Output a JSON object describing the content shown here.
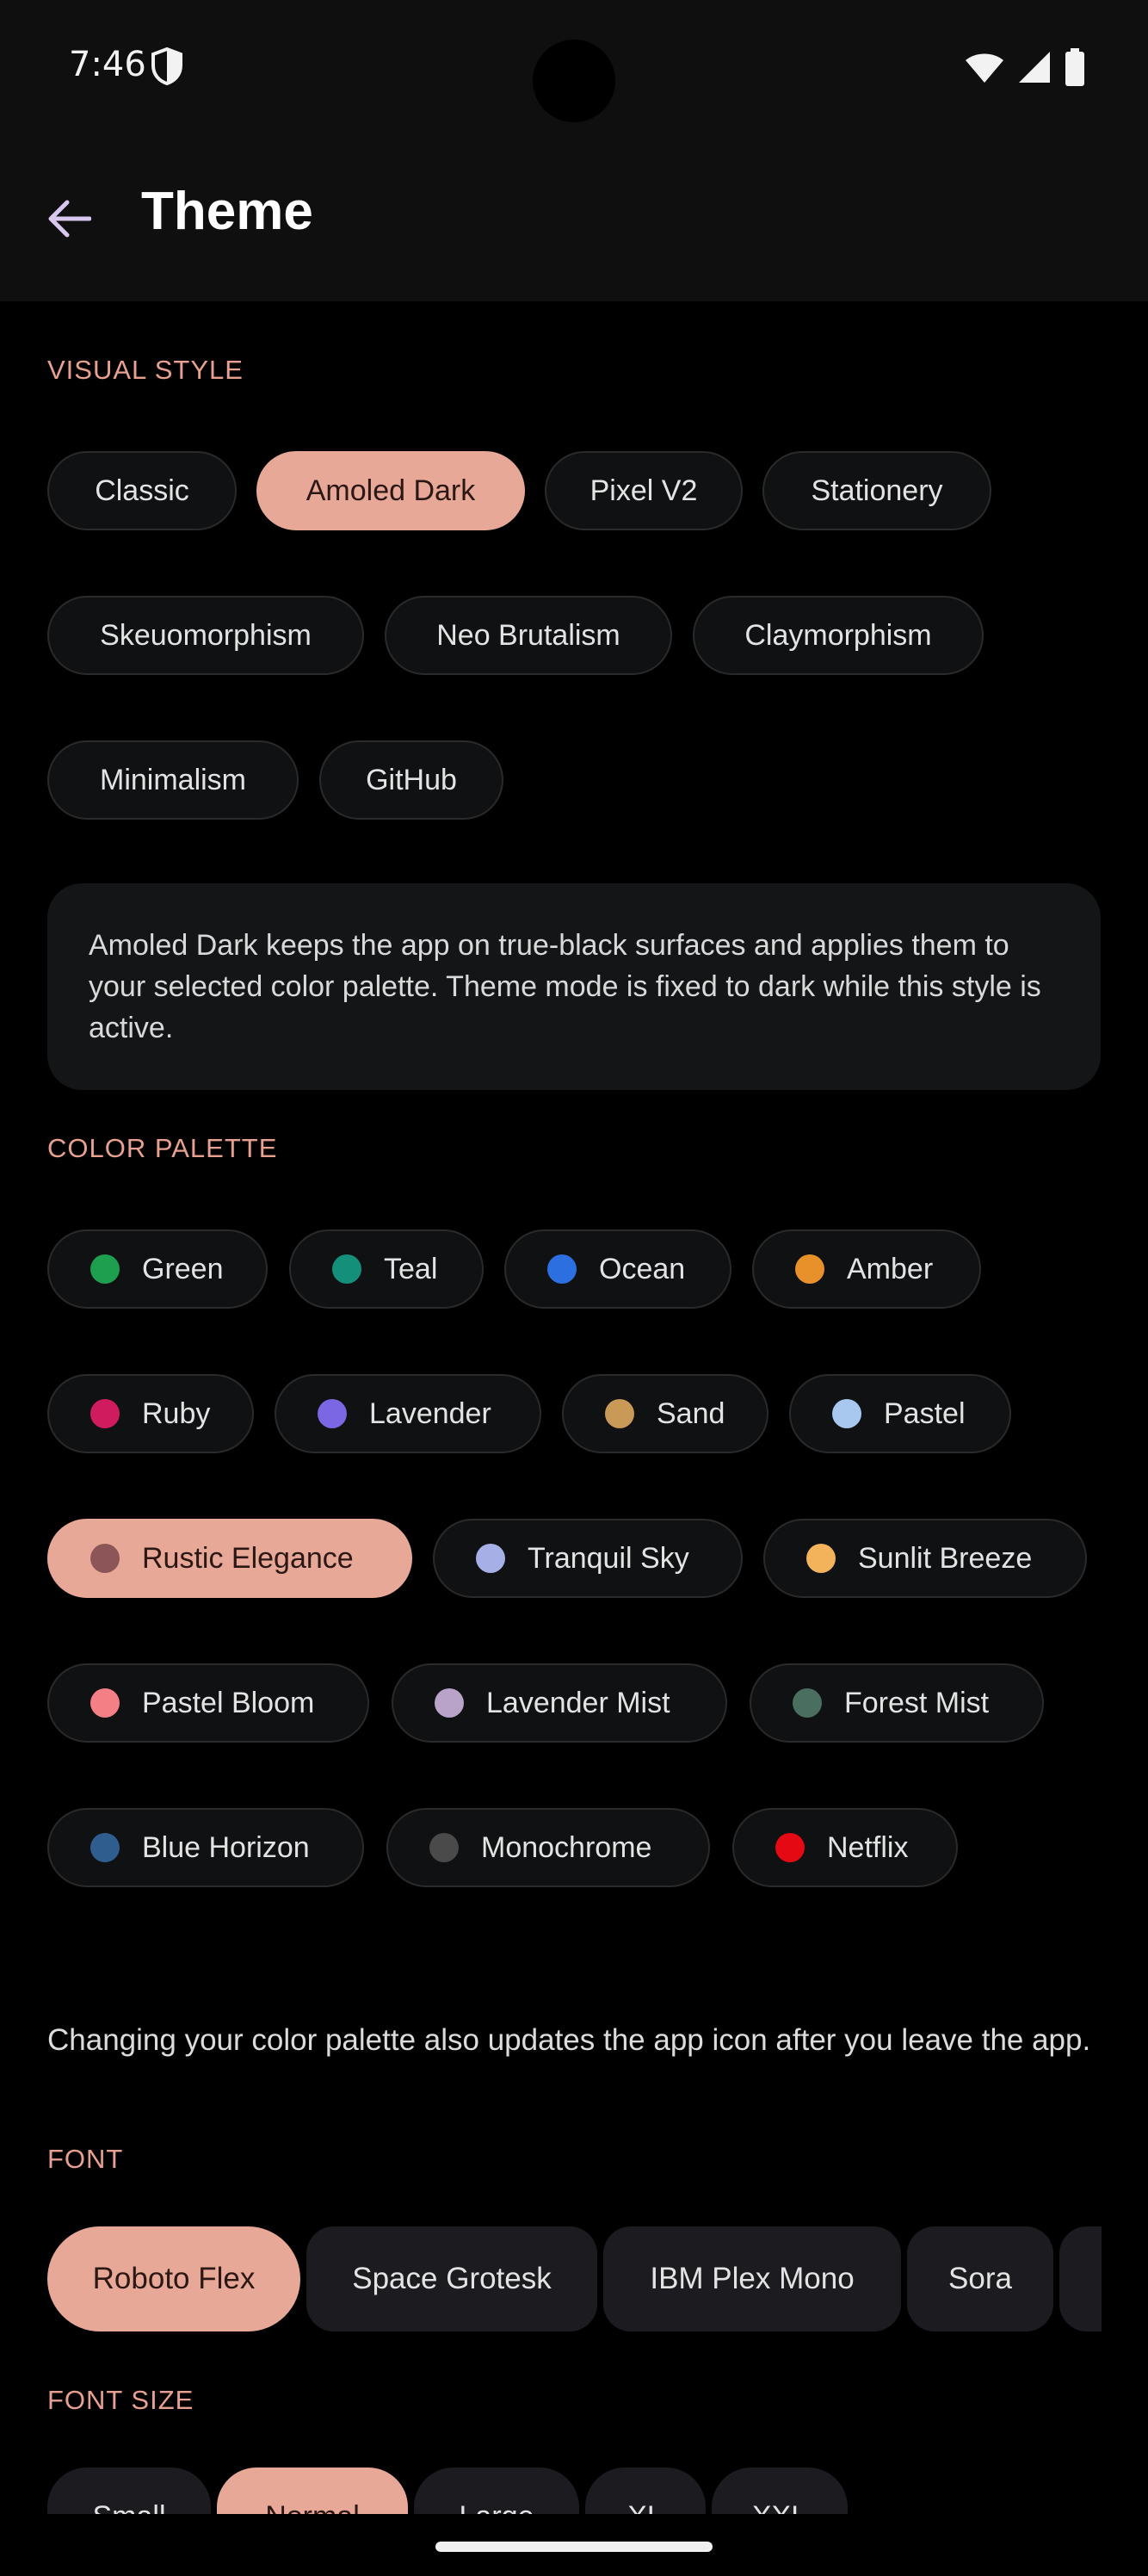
{
  "status": {
    "time": "7:46"
  },
  "header": {
    "title": "Theme"
  },
  "visual_style": {
    "label": "VISUAL STYLE",
    "options": [
      "Classic",
      "Amoled Dark",
      "Pixel V2",
      "Stationery",
      "Skeuomorphism",
      "Neo Brutalism",
      "Claymorphism",
      "Minimalism",
      "GitHub"
    ],
    "selected": "Amoled Dark",
    "description": "Amoled Dark keeps the app on true-black surfaces and applies them to your selected color palette. Theme mode is fixed to dark while this style is active."
  },
  "color_palette": {
    "label": "COLOR PALETTE",
    "options": [
      {
        "name": "Green",
        "color": "#1e9e4f"
      },
      {
        "name": "Teal",
        "color": "#138f7a"
      },
      {
        "name": "Ocean",
        "color": "#2c6fe0"
      },
      {
        "name": "Amber",
        "color": "#e8912a"
      },
      {
        "name": "Ruby",
        "color": "#d01c5f"
      },
      {
        "name": "Lavender",
        "color": "#7b66e3"
      },
      {
        "name": "Sand",
        "color": "#c99a57"
      },
      {
        "name": "Pastel",
        "color": "#a9c8f0"
      },
      {
        "name": "Rustic Elegance",
        "color": "#8c5658"
      },
      {
        "name": "Tranquil Sky",
        "color": "#a7b0e6"
      },
      {
        "name": "Sunlit Breeze",
        "color": "#f2b35b"
      },
      {
        "name": "Pastel Bloom",
        "color": "#f47f84"
      },
      {
        "name": "Lavender Mist",
        "color": "#b9a3c9"
      },
      {
        "name": "Forest Mist",
        "color": "#4a6e60"
      },
      {
        "name": "Blue Horizon",
        "color": "#2f5d8e"
      },
      {
        "name": "Monochrome",
        "color": "#4a4a4a"
      },
      {
        "name": "Netflix",
        "color": "#e50914"
      }
    ],
    "selected": "Rustic Elegance",
    "note": "Changing your color palette also updates the app icon after you leave the app."
  },
  "font": {
    "label": "FONT",
    "options": [
      "Roboto Flex",
      "Space Grotesk",
      "IBM Plex Mono",
      "Sora"
    ],
    "selected": "Roboto Flex"
  },
  "font_size": {
    "label": "FONT SIZE",
    "options": [
      "Small",
      "Normal",
      "Large",
      "XL",
      "XXL"
    ],
    "selected": "Normal"
  },
  "theme": {
    "accent": "#e8a898",
    "section_label": "#e8a08f",
    "background": "#000000"
  }
}
